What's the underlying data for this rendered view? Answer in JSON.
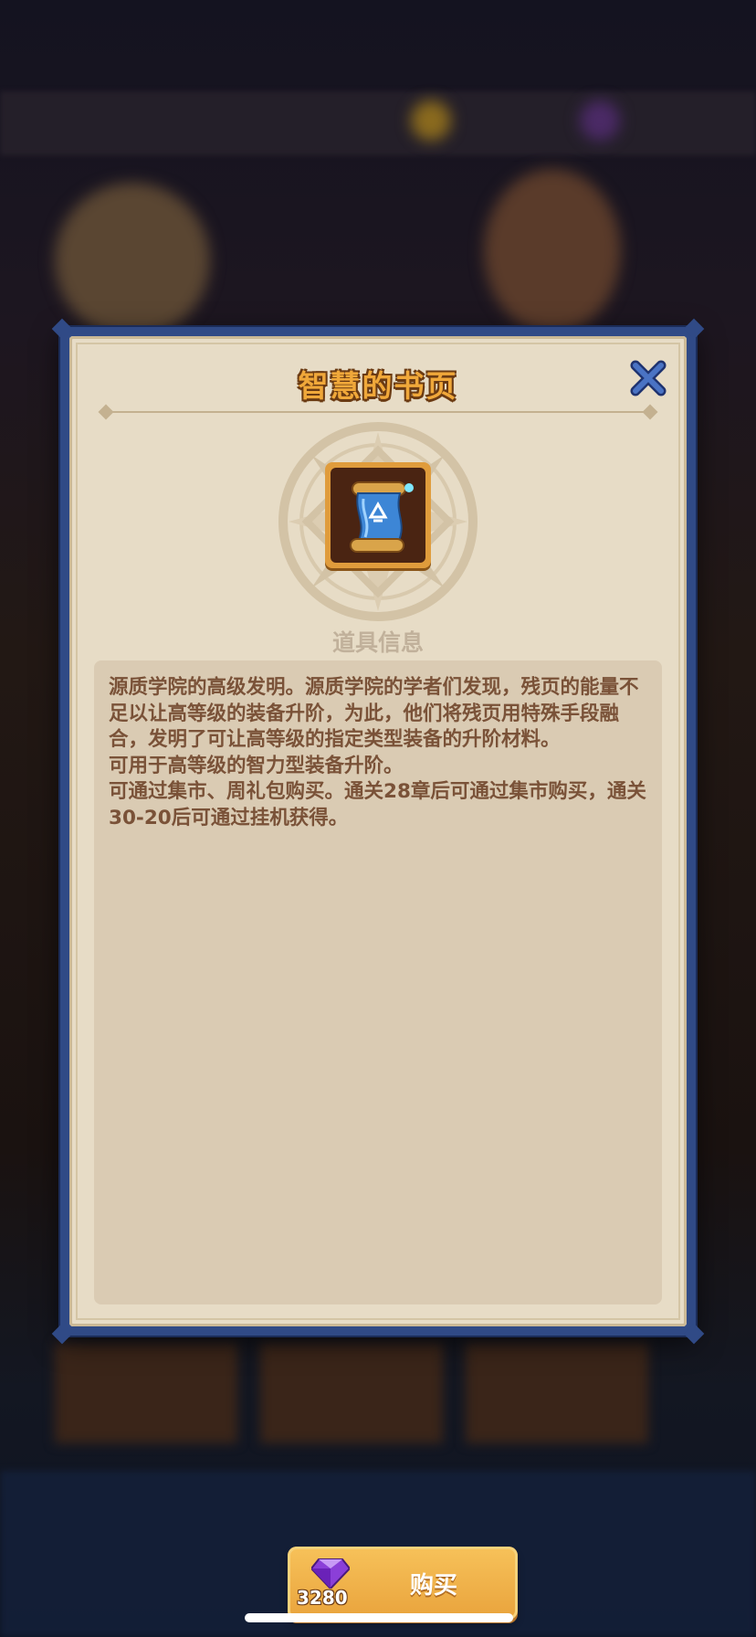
{
  "dialog": {
    "title": "智慧的书页",
    "close_icon": "close-x-icon",
    "item_icon": "scroll-icon",
    "section_label": "道具信息",
    "description": "源质学院的高级发明。源质学院的学者们发现，残页的能量不足以让高等级的装备升阶，为此，他们将残页用特殊手段融合，发明了可让高等级的指定类型装备的升阶材料。\n可用于高等级的智力型装备升阶。\n可通过集市、周礼包购买。通关28章后可通过集市购买，通关30-20后可通过挂机获得。",
    "buy_button": {
      "currency_icon": "purple-gem-icon",
      "price": "3280",
      "label": "购买"
    }
  },
  "colors": {
    "frame": "#304a86",
    "panel": "#e7dcc6",
    "title": "#f0a83a",
    "text": "#7a5238",
    "button": "#f2b44c"
  }
}
